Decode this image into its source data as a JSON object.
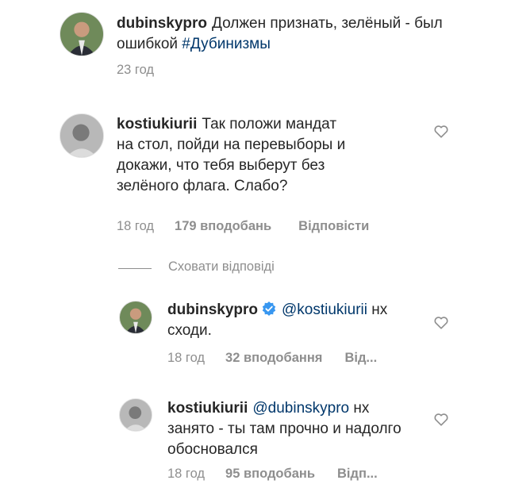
{
  "caption": {
    "username": "dubinskypro",
    "text": "Должен признать, зелёный - был ошибкой",
    "hashtag": "#Дубинизмы",
    "time": "23 год"
  },
  "comment1": {
    "username": "kostiukiurii",
    "text": "Так положи мандат на стол,  пойди на перевыборы и докажи, что тебя выберут без зелёного флага. Слабо?",
    "time": "18 год",
    "likes": "179 вподобань",
    "reply": "Відповісти"
  },
  "hide_replies": "Сховати відповіді",
  "reply1": {
    "username": "dubinskypro",
    "mention": "@kostiukiurii",
    "text": "нх сходи.",
    "time": "18 год",
    "likes": "32 вподобання",
    "reply": "Від..."
  },
  "reply2": {
    "username": "kostiukiurii",
    "mention": "@dubinskypro",
    "text": "нх занято - ты там прочно и надолго обосновался",
    "time": "18 год",
    "likes": "95 вподобань",
    "reply": "Відп..."
  },
  "icons": {
    "heart": "heart-outline-icon",
    "verified": "verified-badge-icon"
  },
  "colors": {
    "link": "#00376b",
    "verified": "#3897f0",
    "meta": "#8e8e8e"
  }
}
